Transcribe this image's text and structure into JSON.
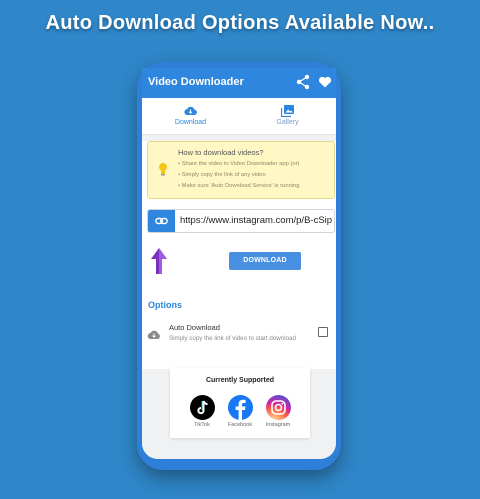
{
  "headline": "Auto Download Options Available Now..",
  "app": {
    "title": "Video Downloader",
    "share_icon": "share-icon",
    "favorite_icon": "heart-icon"
  },
  "tabs": [
    {
      "label": "Download",
      "icon": "cloud-download-icon",
      "active": true
    },
    {
      "label": "Gallery",
      "icon": "gallery-icon",
      "active": false
    }
  ],
  "how_to": {
    "heading": "How to download videos?",
    "items": [
      "Share the video to Video Downloader app (or)",
      "Simply copy the link of any video",
      "Make sure 'Auto Download Service' is running"
    ]
  },
  "url_input": {
    "value": "https://www.instagram.com/p/B-cSip"
  },
  "download_button": "DOWNLOAD",
  "options": {
    "heading": "Options",
    "auto_download": {
      "title": "Auto Download",
      "subtitle": "Simply copy the link of video to start download",
      "checked": false
    }
  },
  "supported": {
    "heading": "Currently Supported",
    "platforms": [
      {
        "name": "TikTok",
        "color": "#000000"
      },
      {
        "name": "Facebook",
        "color": "#1877f2"
      },
      {
        "name": "Instagram",
        "color": "#e1306c"
      }
    ]
  },
  "colors": {
    "background": "#2f86c8",
    "primary": "#2e86de",
    "howto_bg": "#fff8c4"
  }
}
